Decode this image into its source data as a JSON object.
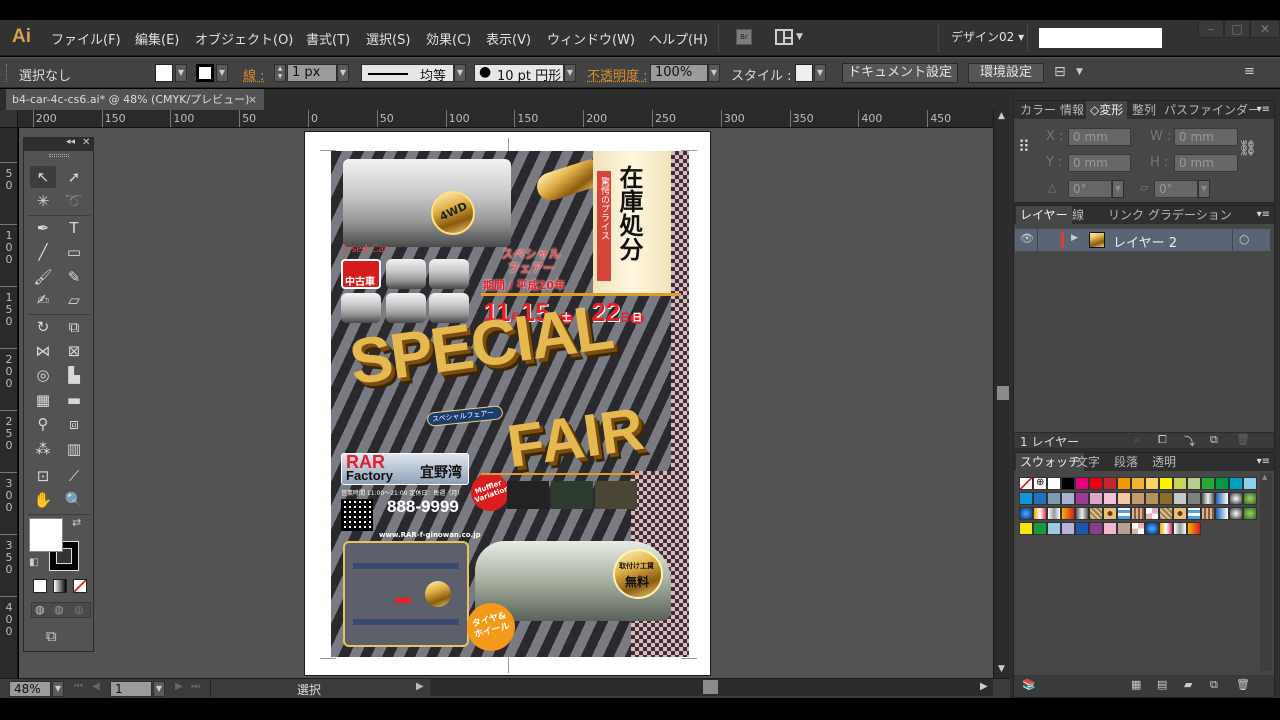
{
  "app": {
    "logo": "Ai",
    "menus": [
      "ファイル(F)",
      "編集(E)",
      "オブジェクト(O)",
      "書式(T)",
      "選択(S)",
      "効果(C)",
      "表示(V)",
      "ウィンドウ(W)",
      "ヘルプ(H)"
    ],
    "bridge_label": "Br",
    "workspace": "デザイン02 ▾",
    "search_placeholder": "",
    "window_controls": [
      "–",
      "□",
      "✕"
    ]
  },
  "controlbar": {
    "selection": "選択なし",
    "fill_color": "#ffffff",
    "stroke_label": "線 :",
    "stroke_weight": "1 px",
    "stroke_profile": "均等",
    "brush": "10 pt 円形",
    "opacity_label": "不透明度 :",
    "opacity_value": "100%",
    "style_label": "スタイル :",
    "document_setup": "ドキュメント設定",
    "preferences": "環境設定"
  },
  "document": {
    "tab_title": "b4-car-4c-cs6.ai* @ 48% (CMYK/プレビュー)",
    "tab_close": "×"
  },
  "rulers": {
    "horizontal": [
      "200",
      "150",
      "100",
      "50",
      "0",
      "50",
      "100",
      "150",
      "200",
      "250",
      "300",
      "350",
      "400",
      "450",
      "5"
    ],
    "vertical": [
      "50",
      "100",
      "150",
      "200",
      "250",
      "300",
      "350",
      "400"
    ]
  },
  "poster": {
    "title_main": "SPECIAL",
    "title_sub": "FAIR",
    "title_kana": "スペシャルフェアー",
    "stock_sale": "在庫処分",
    "shocking_price": "驚愕のプライス",
    "badge_4wd": "4WD",
    "used_car": "Used Car",
    "special_used": "中古車",
    "fair_label": "スペシャルフェアー",
    "period": "期間 / 平成20年",
    "date_start_month": "11",
    "date_start_day": "15",
    "date_start_weekday": "土",
    "date_end_day": "22",
    "date_end_weekday": "日",
    "shop_name_1": "RAR",
    "shop_name_2": "Factory",
    "shop_location": "宜野湾",
    "hours": "営業時間 11:00〜21:00 定休日：毎週（月）",
    "phone": "888-9999",
    "url": "www.RAR-f-ginowan.co.jp",
    "muffler": "Muffler Variation",
    "install_label": "取付け工賃",
    "install_free": "無料",
    "tire_wheel": "タイヤ&ホイール"
  },
  "transform_panel": {
    "tabs": [
      "カラー",
      "情報",
      "◇変形",
      "整列",
      "パスファインダー"
    ],
    "active_tab": 2,
    "x_label": "X :",
    "x_value": "0 mm",
    "y_label": "Y :",
    "y_value": "0 mm",
    "w_label": "W :",
    "w_value": "0 mm",
    "h_label": "H :",
    "h_value": "0 mm",
    "rotate_value": "0°",
    "shear_value": "0°"
  },
  "layers_panel": {
    "tabs": [
      "レイヤー",
      "線",
      "リンク",
      "グラデーション"
    ],
    "active_tab": 0,
    "layers": [
      {
        "name": "レイヤー 2",
        "color": "#e23a3a",
        "visible": true
      }
    ],
    "count": "1 レイヤー"
  },
  "swatches_panel": {
    "tabs": [
      "スウォッチ",
      "文字",
      "段落",
      "透明"
    ],
    "active_tab": 0,
    "rows": [
      [
        "none",
        "registration",
        "#ffffff",
        "#000000",
        "#e4007f",
        "#e60012",
        "#c1272d",
        "#f39800",
        "#f5b335",
        "#f8d36b",
        "#fff100",
        "#c7d65a",
        "#b5d08c",
        "#22ac38",
        "#009944",
        "#00a0c1",
        "#8fcfee"
      ],
      [
        "#0d96d8",
        "#1d6fbf",
        "#7d9bb3",
        "#a6b3cf",
        "#9b3d94",
        "#e0a3c9",
        "#f4c1d6",
        "#f2c9a0",
        "#c59b6d",
        "#b2945c",
        "#8c6d2a",
        "#c8c8c8",
        "#808080",
        "grad",
        "grad",
        "grad",
        "grad"
      ],
      [
        "grad",
        "grad",
        "grad",
        "grad",
        "grad",
        "pattern",
        "pattern",
        "pattern",
        "pattern",
        "pattern",
        "pattern",
        "pattern",
        "pattern",
        "pattern",
        "grad",
        "grad",
        "grad"
      ],
      [
        "#f5e60c",
        "#1a9a3a",
        "#9fc8e8",
        "#b3b3d9",
        "#1b58a8",
        "#8c3c8c",
        "#f0b8d0",
        "#b8a090",
        "pattern",
        "grad",
        "grad",
        "grad",
        "grad"
      ]
    ]
  },
  "statusbar": {
    "zoom": "48%",
    "artboard": "1",
    "tool": "選択"
  }
}
